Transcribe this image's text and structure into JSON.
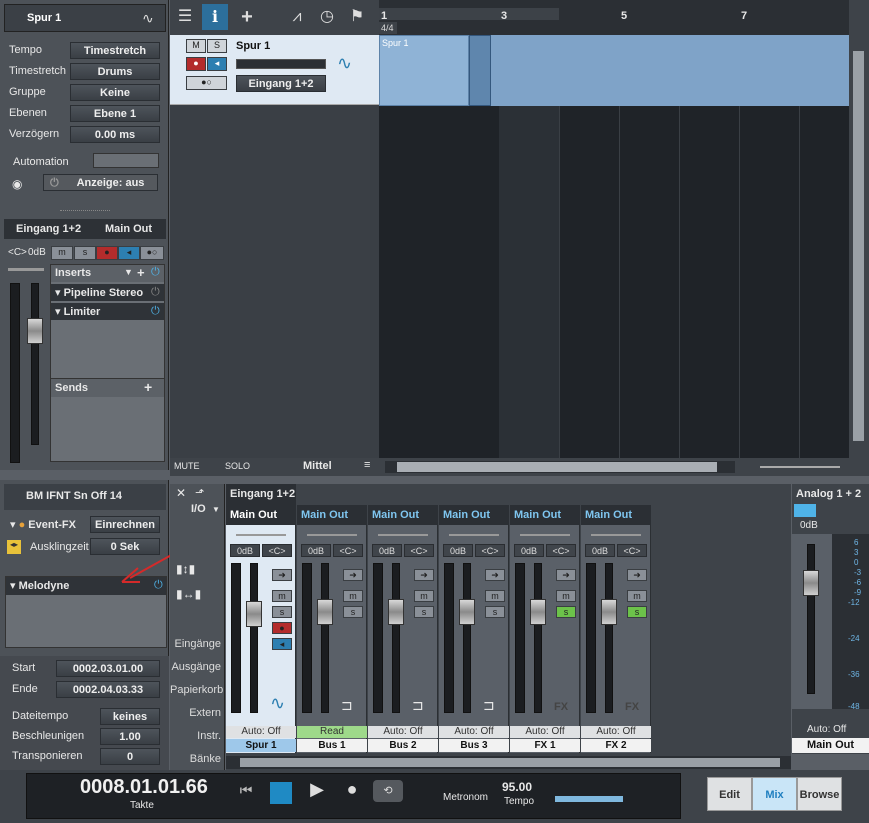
{
  "inspector": {
    "track_name": "Spur 1",
    "rows": [
      {
        "label": "Tempo",
        "value": "Timestretch"
      },
      {
        "label": "Timestretch",
        "value": "Drums"
      },
      {
        "label": "Gruppe",
        "value": "Keine"
      },
      {
        "label": "Ebenen",
        "value": "Ebene 1"
      },
      {
        "label": "Verzögern",
        "value": "0.00 ms"
      }
    ],
    "automation_label": "Automation",
    "automation_display": "Anzeige: aus",
    "io_in": "Eingang 1+2",
    "io_out": "Main Out",
    "db": "0dB",
    "pan": "<C>",
    "inserts_label": "Inserts",
    "insert1": "Pipeline Stereo",
    "insert2": "Limiter",
    "sends_label": "Sends"
  },
  "event": {
    "title": "BM IFNT Sn Off 14",
    "eventfx_label": "Event-FX",
    "render_button": "Einrechnen",
    "tail_label": "Ausklingzeit",
    "tail_value": "0 Sek",
    "plugin": "Melodyne",
    "rows": [
      {
        "label": "Start",
        "value": "0002.03.01.00"
      },
      {
        "label": "Ende",
        "value": "0002.04.03.33"
      }
    ],
    "file_tempo_label": "Dateitempo",
    "file_tempo_value": "keines",
    "speedup_label": "Beschleunigen",
    "speedup_value": "1.00",
    "transpose_label": "Transponieren",
    "transpose_value": "0"
  },
  "toolbar": {
    "icons": [
      "list-icon",
      "info-icon",
      "add-icon",
      "automation-icon",
      "clock-icon",
      "flag-icon"
    ]
  },
  "ruler": {
    "marks": [
      "1",
      "3",
      "5",
      "7"
    ],
    "signature": "4/4"
  },
  "track": {
    "name": "Spur 1",
    "m": "M",
    "s": "S",
    "input": "Eingang 1+2",
    "clip_name": "Spur 1"
  },
  "arrange_footer": {
    "mute": "MUTE",
    "solo": "SOLO",
    "size": "Mittel"
  },
  "mixer": {
    "io_label": "I/O",
    "side_items": [
      "Eingänge",
      "Ausgänge",
      "Papierkorb",
      "Extern",
      "Instr.",
      "Bänke"
    ],
    "strip1_in": "Eingang 1+2",
    "strips": [
      {
        "out": "Main Out",
        "db": "0dB",
        "pan": "<C>",
        "auto": "Auto: Off",
        "name": "Spur 1"
      },
      {
        "out": "Main Out",
        "db": "0dB",
        "pan": "<C>",
        "auto": "Read",
        "name": "Bus 1"
      },
      {
        "out": "Main Out",
        "db": "0dB",
        "pan": "<C>",
        "auto": "Auto: Off",
        "name": "Bus 2"
      },
      {
        "out": "Main Out",
        "db": "0dB",
        "pan": "<C>",
        "auto": "Auto: Off",
        "name": "Bus 3"
      },
      {
        "out": "Main Out",
        "db": "0dB",
        "pan": "<C>",
        "auto": "Auto: Off",
        "name": "FX 1"
      },
      {
        "out": "Main Out",
        "db": "0dB",
        "pan": "<C>",
        "auto": "Auto: Off",
        "name": "FX 2"
      }
    ],
    "master": {
      "in": "Analog 1 + 2",
      "db": "0dB",
      "auto": "Auto: Off",
      "name": "Main Out",
      "scale": [
        "6",
        "3",
        "0",
        "-3",
        "-6",
        "-9",
        "-12",
        "-24",
        "-36",
        "-48"
      ]
    }
  },
  "transport": {
    "time": "0008.01.01.66",
    "time_unit": "Takte",
    "metronome": "Metronom",
    "tempo": "95.00",
    "tempo_label": "Tempo",
    "views": [
      "Edit",
      "Mix",
      "Browse"
    ]
  },
  "colors": {
    "accent": "#4fb3e8",
    "clip": "#8fb3d6",
    "track_bg": "#dfe9f3"
  }
}
